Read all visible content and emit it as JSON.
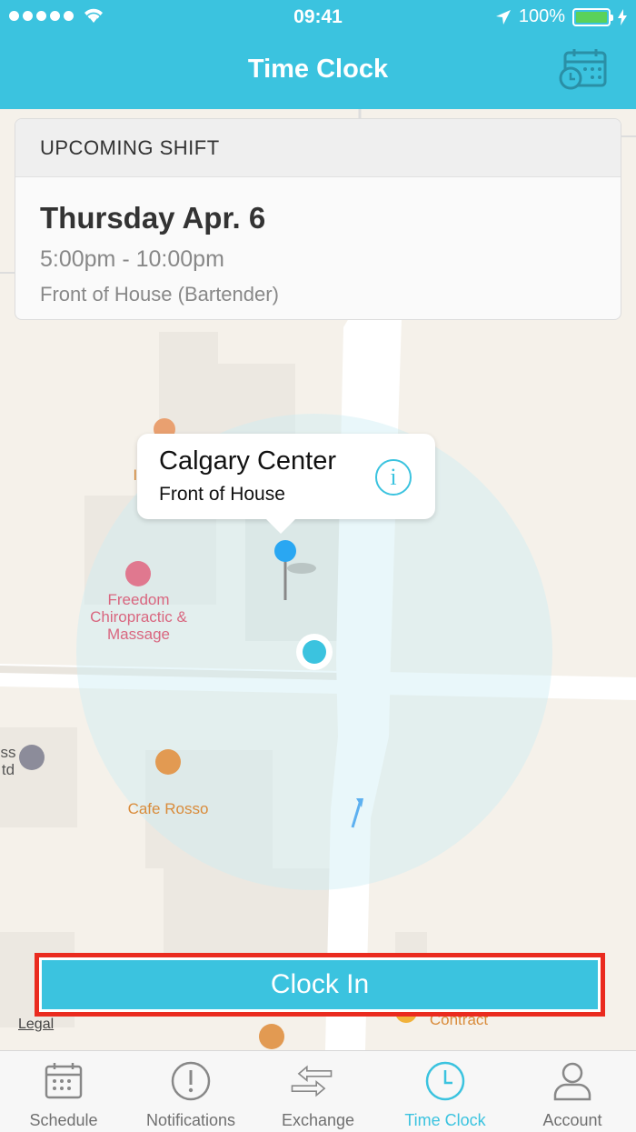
{
  "status_bar": {
    "time": "09:41",
    "battery": "100%"
  },
  "header": {
    "title": "Time Clock"
  },
  "shift_card": {
    "heading": "UPCOMING SHIFT",
    "day": "Thursday Apr. 6",
    "time_range": "5:00pm - 10:00pm",
    "role": "Front of House (Bartender)"
  },
  "map": {
    "callout": {
      "title": "Calgary Center",
      "subtitle": "Front of House",
      "info_glyph": "i"
    },
    "pois": {
      "freedom": "Freedom Chiropractic & Massage",
      "cafe": "Cafe Rosso",
      "ice": "Ic",
      "contract": "Contract",
      "partial_left": "ss\ntd"
    },
    "legal": "Legal"
  },
  "actions": {
    "clock_in": "Clock In"
  },
  "tabs": [
    {
      "label": "Schedule",
      "icon": "calendar-icon",
      "active": false
    },
    {
      "label": "Notifications",
      "icon": "exclamation-icon",
      "active": false
    },
    {
      "label": "Exchange",
      "icon": "exchange-arrows-icon",
      "active": false
    },
    {
      "label": "Time Clock",
      "icon": "clock-icon",
      "active": true
    },
    {
      "label": "Account",
      "icon": "person-icon",
      "active": false
    }
  ],
  "colors": {
    "accent": "#3bc3df",
    "highlight_border": "#ea2b1f",
    "map_bg": "#f5f1ea"
  }
}
